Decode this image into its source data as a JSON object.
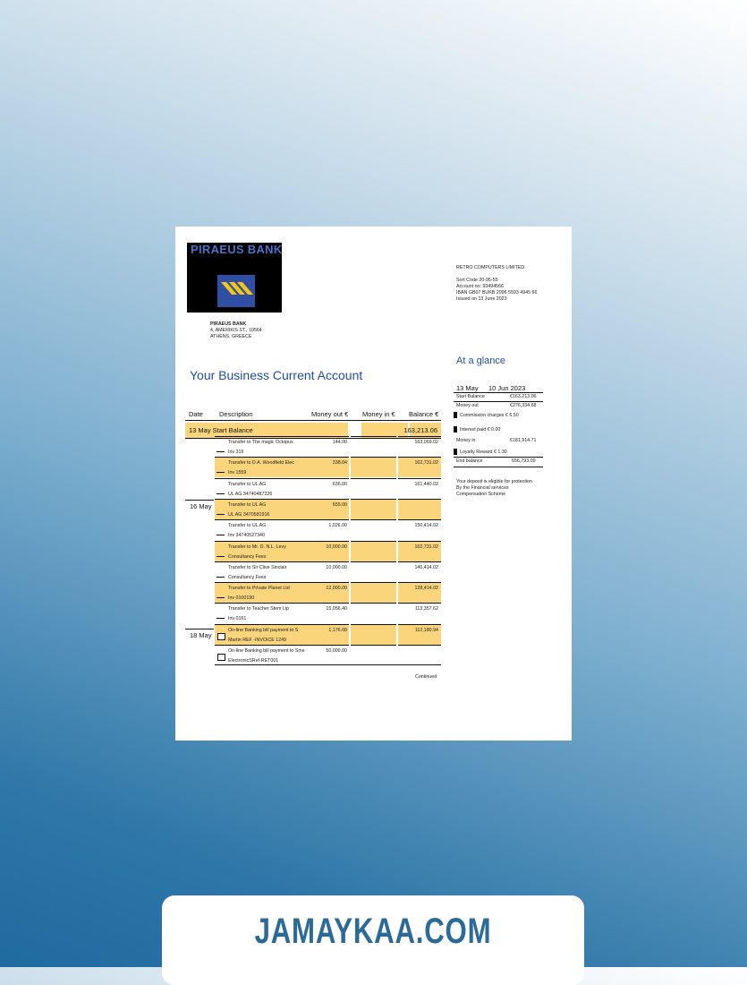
{
  "bank": {
    "logo_text": "PIRAEUS BANK",
    "name": "PIRAEUS BANK",
    "address_line1": "4, AMERIKIS ST., 10564",
    "address_line2": "ATHENS, GREECE"
  },
  "customer": {
    "company": "RETRO COMPUTERS LIMITED",
    "sort_code": "Sort Code 20-95-55",
    "account_no": "Account no: 93494566",
    "iban": "IBAN GB07 BUKB 2096 5593 4945 66",
    "issued": "Issued on 13 June 2023"
  },
  "account_title": "Your Business Current Account",
  "table": {
    "headers": {
      "date": "Date",
      "description": "Description",
      "money_out": "Money out €",
      "money_in": "Money in €",
      "balance": "Balance €"
    },
    "start_label": "13 May Start Balance",
    "start_balance": "163,213.06",
    "day_16": "16 May",
    "day_18": "18 May",
    "rows": [
      {
        "d1": "Transfer to The magic Octopus",
        "d2": "Inv 319",
        "out": "144.00",
        "bal": "163,069.02"
      },
      {
        "d1": "Transfer to D.A. Woodfield Elec",
        "d2": "Inv 1559",
        "out": "338.04",
        "bal": "162,731.02"
      },
      {
        "d1": "Transfer to UL AG",
        "d2": "UL AG 34740487226",
        "out": "636.00",
        "bal": "161,440.02"
      },
      {
        "d1": "Transfer to UL AG",
        "d2": "UL AG 3470581916",
        "out": "655.00",
        "bal": ""
      },
      {
        "d1": "Transfer to UL AG",
        "d2": "Inv 34740527340",
        "out": "1,026.00",
        "bal": "150,414.02"
      },
      {
        "d1": "Transfer to Mr. D. N.L. Levy",
        "d2": "Consultancy Fees",
        "out": "10,000.00",
        "bal": "162,731.02"
      },
      {
        "d1": "Transfer to Sir Clive Sinclair",
        "d2": "Consultancy Fees",
        "out": "10,000.00",
        "bal": "140,414.02"
      },
      {
        "d1": "Transfer to Private Planet Ltd",
        "d2": "Inv 0100190",
        "out": "12,000.00",
        "bal": "128,414.02"
      },
      {
        "d1": "Transfer to Teacher Stem Lip",
        "d2": "Inv 0161",
        "out": "15,056.40",
        "bal": "113,357.62"
      },
      {
        "d1": "On-line Banking bill payment to S",
        "d2": "Martin REF -INVOICE 1249",
        "out": "1,176.68",
        "bal": "112,180.94"
      },
      {
        "d1": "On-line Banking bill payment to Sms",
        "d2": "ElectronicSRef-RET001",
        "out": "50,000.00",
        "bal": ""
      }
    ],
    "continued": "Continued"
  },
  "glance": {
    "title": "At a glance",
    "from": "13 May",
    "to": "10 Jun 2023",
    "start_label": "Start Balance",
    "start_value": "€163,213.06",
    "out_label": "Money out",
    "out_value": "€276,334.68",
    "commission": "Commission charges € 6.50",
    "interest": "Interest paid € 0.00",
    "in_label": "Money in",
    "in_value": "€181,914.71",
    "loyalty": "Loyalty Reward € 1.30",
    "end_label": "End balance",
    "end_value": "656,793.09",
    "note1": "Your deposit is eligible for protection",
    "note2": "By the Financial services",
    "note3": "Compensation Scheme"
  },
  "watermark": "JAMAYKAA.COM",
  "colors": {
    "highlight": "#fbd57c",
    "title_blue": "#1f4e9b",
    "banner_text": "#2c6a97"
  }
}
